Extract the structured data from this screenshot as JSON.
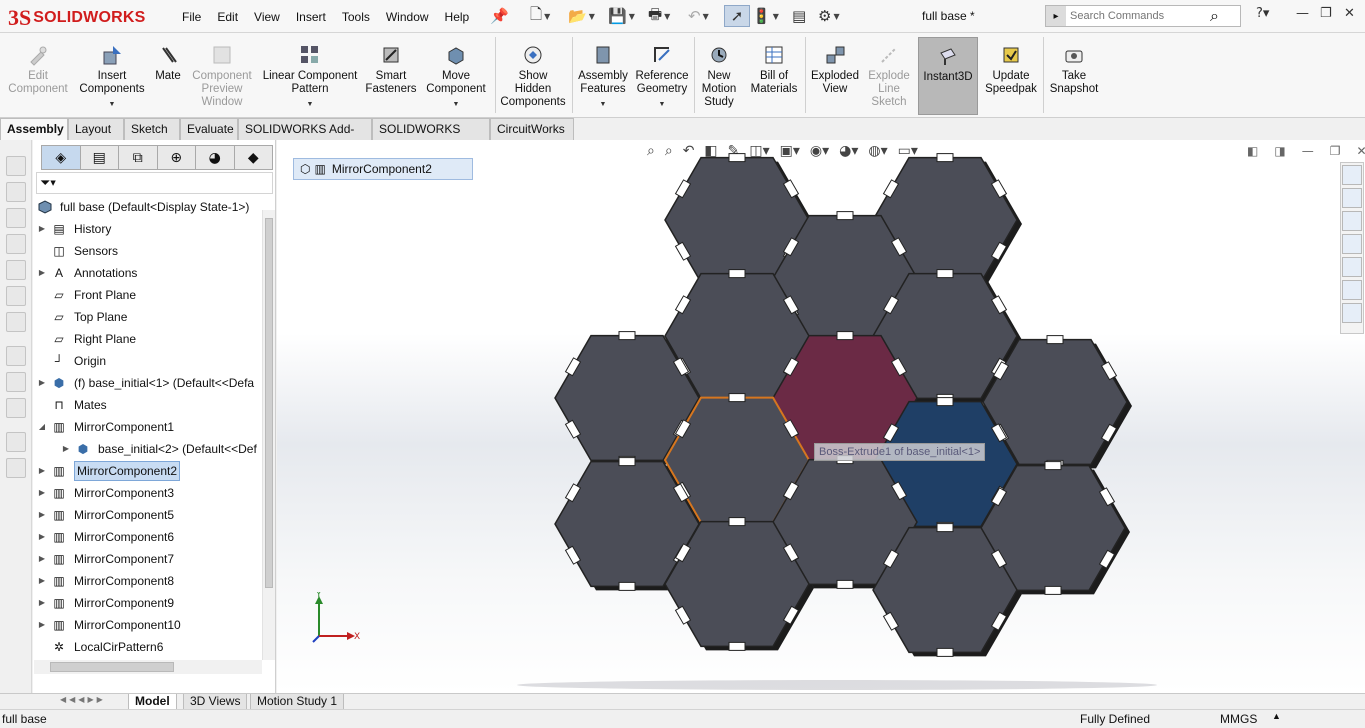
{
  "app": {
    "brand": "SOLIDWORKS",
    "brand_mark": "3S",
    "doc_title": "full base *"
  },
  "menu": [
    "File",
    "Edit",
    "View",
    "Insert",
    "Tools",
    "Window",
    "Help"
  ],
  "search": {
    "placeholder": "Search Commands"
  },
  "commands": [
    {
      "label": "Edit\nComponent",
      "icon": "edit-component-icon",
      "disabled": true
    },
    {
      "label": "Insert\nComponents",
      "icon": "insert-components-icon",
      "disabled": false,
      "dropdown": true
    },
    {
      "label": "Mate",
      "icon": "mate-icon",
      "disabled": false
    },
    {
      "label": "Component\nPreview\nWindow",
      "icon": "component-preview-icon",
      "disabled": true
    },
    {
      "label": "Linear Component\nPattern",
      "icon": "linear-pattern-icon",
      "disabled": false,
      "dropdown": true
    },
    {
      "label": "Smart\nFasteners",
      "icon": "smart-fasteners-icon",
      "disabled": false
    },
    {
      "label": "Move\nComponent",
      "icon": "move-component-icon",
      "disabled": false,
      "dropdown": true
    },
    {
      "label": "Show\nHidden\nComponents",
      "icon": "show-hidden-icon",
      "disabled": false
    },
    {
      "label": "Assembly\nFeatures",
      "icon": "assembly-features-icon",
      "disabled": false,
      "dropdown": true
    },
    {
      "label": "Reference\nGeometry",
      "icon": "reference-geometry-icon",
      "disabled": false,
      "dropdown": true
    },
    {
      "label": "New\nMotion\nStudy",
      "icon": "motion-study-icon",
      "disabled": false
    },
    {
      "label": "Bill of\nMaterials",
      "icon": "bom-icon",
      "disabled": false
    },
    {
      "label": "Exploded\nView",
      "icon": "exploded-view-icon",
      "disabled": false
    },
    {
      "label": "Explode\nLine\nSketch",
      "icon": "explode-line-icon",
      "disabled": true
    },
    {
      "label": "Instant3D",
      "icon": "instant3d-icon",
      "disabled": false,
      "active": true
    },
    {
      "label": "Update\nSpeedpak",
      "icon": "speedpak-icon",
      "disabled": false
    },
    {
      "label": "Take\nSnapshot",
      "icon": "snapshot-icon",
      "disabled": false
    }
  ],
  "command_tabs": [
    "Assembly",
    "Layout",
    "Sketch",
    "Evaluate",
    "SOLIDWORKS Add-Ins",
    "SOLIDWORKS MBD",
    "CircuitWorks"
  ],
  "tree": {
    "root": "full base  (Default<Display State-1>)",
    "items": [
      {
        "label": "History",
        "expand": true
      },
      {
        "label": "Sensors",
        "expand": false
      },
      {
        "label": "Annotations",
        "expand": true
      },
      {
        "label": "Front Plane",
        "expand": false
      },
      {
        "label": "Top Plane",
        "expand": false
      },
      {
        "label": "Right Plane",
        "expand": false
      },
      {
        "label": "Origin",
        "expand": false
      },
      {
        "label": "(f) base_initial<1> (Default<<Defa",
        "expand": true
      },
      {
        "label": "Mates",
        "expand": false
      },
      {
        "label": "MirrorComponent1",
        "expand": true,
        "open": true
      },
      {
        "label": "base_initial<2> (Default<<Def",
        "expand": true,
        "child": true
      },
      {
        "label": "MirrorComponent2",
        "expand": true,
        "selected": true
      },
      {
        "label": "MirrorComponent3",
        "expand": true
      },
      {
        "label": "MirrorComponent5",
        "expand": true
      },
      {
        "label": "MirrorComponent6",
        "expand": true
      },
      {
        "label": "MirrorComponent7",
        "expand": true
      },
      {
        "label": "MirrorComponent8",
        "expand": true
      },
      {
        "label": "MirrorComponent9",
        "expand": true
      },
      {
        "label": "MirrorComponent10",
        "expand": true
      },
      {
        "label": "LocalCirPattern6",
        "expand": false
      }
    ]
  },
  "viewport": {
    "breadcrumb": "MirrorComponent2",
    "tooltip": "Boss-Extrude1 of base_initial<1>",
    "triad": {
      "y": "Y",
      "x": "X"
    },
    "colors": {
      "plate": "#4b4d57",
      "highlight_red": "#6b2a45",
      "highlight_blue": "#1f3f66",
      "selected_outline": "#d6761f"
    }
  },
  "bottom_tabs": [
    "Model",
    "3D Views",
    "Motion Study 1"
  ],
  "status": {
    "left": "full base",
    "state": "Fully Defined",
    "units": "MMGS"
  }
}
